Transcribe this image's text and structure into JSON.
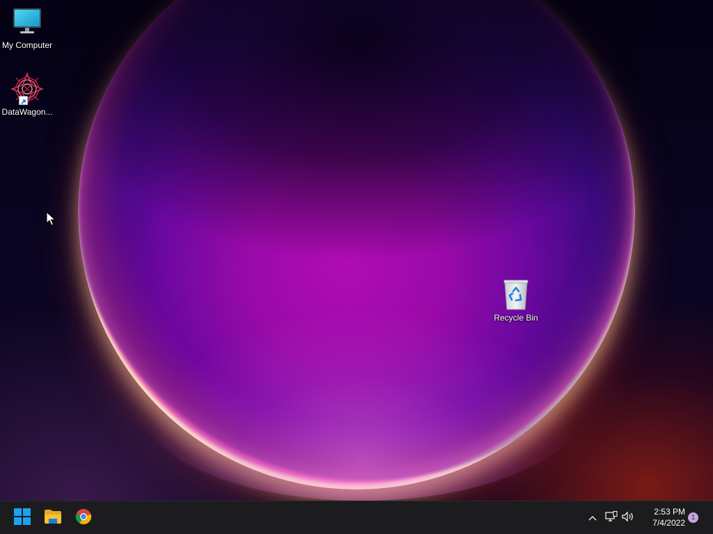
{
  "desktop": {
    "icons": [
      {
        "label": "My Computer",
        "icon": "monitor-icon"
      },
      {
        "label": "DataWagon...",
        "icon": "datawagon-logo-icon"
      },
      {
        "label": "Recycle Bin",
        "icon": "recycle-bin-icon"
      }
    ]
  },
  "taskbar": {
    "buttons": [
      {
        "name": "Start",
        "icon": "windows-logo-icon"
      },
      {
        "name": "File Explorer",
        "icon": "folder-icon"
      },
      {
        "name": "Google Chrome",
        "icon": "chrome-icon"
      }
    ],
    "tray": {
      "icons": [
        "chevron-up-icon",
        "network-icon",
        "volume-icon"
      ]
    },
    "clock": {
      "time": "2:53 PM",
      "date": "7/4/2022"
    },
    "notification_count": "1"
  },
  "colors": {
    "taskbar_bg": "#1c1c1e",
    "windows_blue": "#1aa3f0",
    "folder_yellow": "#f5c235",
    "badge": "#c7a4e0"
  }
}
